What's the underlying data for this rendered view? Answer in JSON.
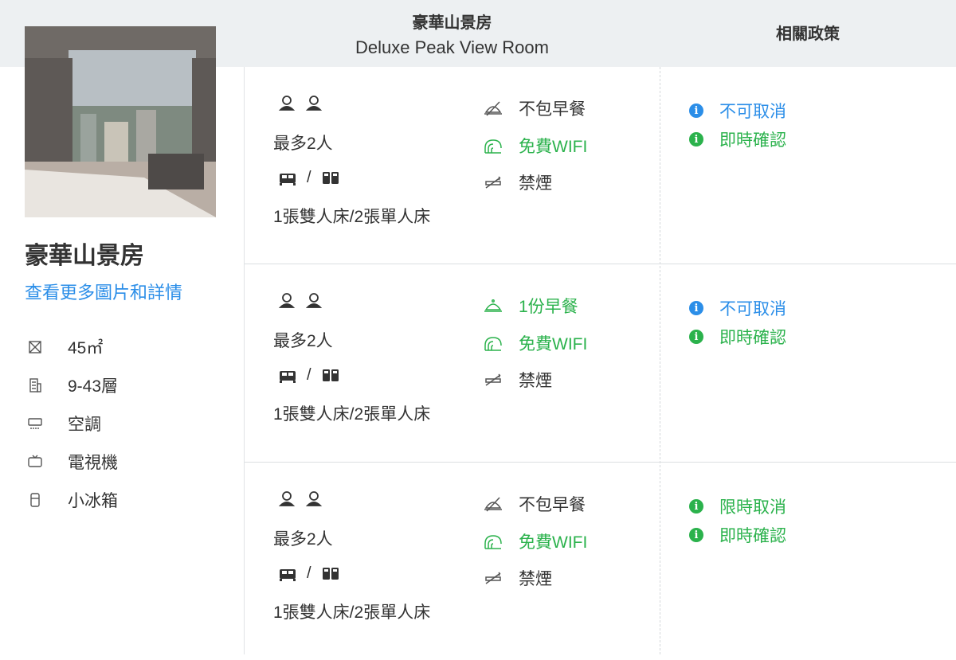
{
  "header": {
    "room_name_zh": "豪華山景房",
    "room_name_en": "Deluxe Peak View Room",
    "policy_title": "相關政策"
  },
  "room": {
    "title": "豪華山景房",
    "details_link": "查看更多圖片和詳情",
    "photo_icon": "hotel-room-photo",
    "amenities": [
      {
        "icon": "area-icon",
        "label": "45㎡"
      },
      {
        "icon": "building-icon",
        "label": "9-43層"
      },
      {
        "icon": "air-conditioner-icon",
        "label": "空調"
      },
      {
        "icon": "tv-icon",
        "label": "電視機"
      },
      {
        "icon": "fridge-icon",
        "label": "小冰箱"
      }
    ]
  },
  "colors": {
    "green": "#2bb24c",
    "blue": "#2b8ee8",
    "header_bg": "#edf0f2"
  },
  "rates": [
    {
      "max_people": "最多2人",
      "bed_sep": "/",
      "bed_type": "1張雙人床/2張單人床",
      "breakfast": "不包早餐",
      "breakfast_included": false,
      "wifi": "免費WIFI",
      "smoking": "禁煙",
      "policy_cancel": "不可取消",
      "policy_cancel_color": "blue",
      "policy_confirm": "即時確認"
    },
    {
      "max_people": "最多2人",
      "bed_sep": "/",
      "bed_type": "1張雙人床/2張單人床",
      "breakfast": "1份早餐",
      "breakfast_included": true,
      "wifi": "免費WIFI",
      "smoking": "禁煙",
      "policy_cancel": "不可取消",
      "policy_cancel_color": "blue",
      "policy_confirm": "即時確認"
    },
    {
      "max_people": "最多2人",
      "bed_sep": "/",
      "bed_type": "1張雙人床/2張單人床",
      "breakfast": "不包早餐",
      "breakfast_included": false,
      "wifi": "免費WIFI",
      "smoking": "禁煙",
      "policy_cancel": "限時取消",
      "policy_cancel_color": "green",
      "policy_confirm": "即時確認"
    }
  ]
}
